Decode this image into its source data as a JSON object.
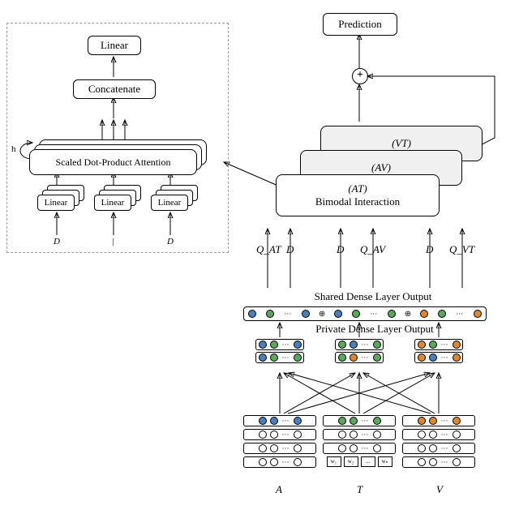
{
  "top": {
    "prediction": "Prediction"
  },
  "attention_panel": {
    "linear_top": "Linear",
    "concat": "Concatenate",
    "sd_attn": "Scaled Dot-Product Attention",
    "linear_small": "Linear",
    "h_label": "h",
    "in_left": "D",
    "in_mid": "|",
    "in_right": "D"
  },
  "bimodal": {
    "vt": "(VT)",
    "av": "(AV)",
    "at_line1": "(AT)",
    "at_line2": "Bimodal Interaction"
  },
  "arrows_labels": {
    "q_at": "Q_AT",
    "d1": "D",
    "d2": "D",
    "q_av": "Q_AV",
    "d3": "D",
    "q_vt": "Q_VT"
  },
  "layers": {
    "shared": "Shared Dense Layer Output",
    "private": "Private Dense Layer Output"
  },
  "modalities": {
    "a": "A",
    "t": "T",
    "v": "V"
  },
  "word_boxes": [
    "w₁",
    "w₂",
    "...",
    "wₙ"
  ],
  "chart_data": {
    "type": "diagram",
    "description": "Multimodal neural architecture with three input encoders A (acoustic), T (text), V (visual) feeding cross-connected private dense layers, concatenated shared dense layer, three bimodal interaction blocks (AT, AV, VT) via multi-head attention, summed to Prediction.",
    "modalities": [
      "A",
      "T",
      "V"
    ],
    "bimodal_blocks": [
      "AT",
      "AV",
      "VT"
    ],
    "attention_inputs_per_block": [
      "Q",
      "D",
      "D"
    ],
    "attention_type": "Multi-head scaled dot-product attention",
    "attention_head_symbol": "h",
    "fusion_op": "element-wise sum"
  }
}
